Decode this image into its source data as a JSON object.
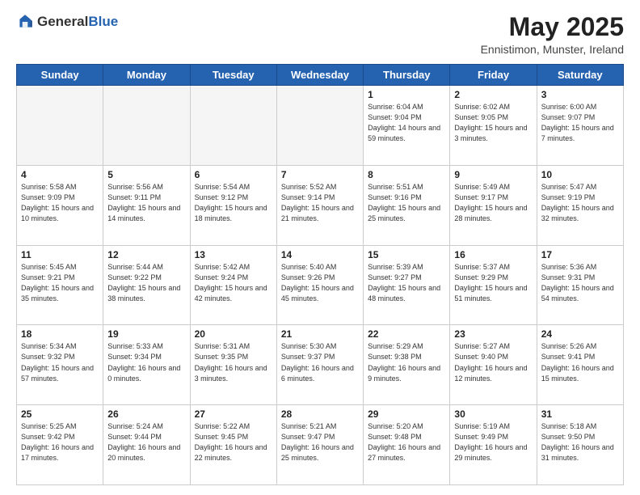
{
  "header": {
    "logo": {
      "general": "General",
      "blue": "Blue"
    },
    "title": "May 2025",
    "location": "Ennistimon, Munster, Ireland"
  },
  "weekdays": [
    "Sunday",
    "Monday",
    "Tuesday",
    "Wednesday",
    "Thursday",
    "Friday",
    "Saturday"
  ],
  "weeks": [
    [
      {
        "day": "",
        "sunrise": "",
        "sunset": "",
        "daylight": ""
      },
      {
        "day": "",
        "sunrise": "",
        "sunset": "",
        "daylight": ""
      },
      {
        "day": "",
        "sunrise": "",
        "sunset": "",
        "daylight": ""
      },
      {
        "day": "",
        "sunrise": "",
        "sunset": "",
        "daylight": ""
      },
      {
        "day": "1",
        "sunrise": "Sunrise: 6:04 AM",
        "sunset": "Sunset: 9:04 PM",
        "daylight": "Daylight: 14 hours and 59 minutes."
      },
      {
        "day": "2",
        "sunrise": "Sunrise: 6:02 AM",
        "sunset": "Sunset: 9:05 PM",
        "daylight": "Daylight: 15 hours and 3 minutes."
      },
      {
        "day": "3",
        "sunrise": "Sunrise: 6:00 AM",
        "sunset": "Sunset: 9:07 PM",
        "daylight": "Daylight: 15 hours and 7 minutes."
      }
    ],
    [
      {
        "day": "4",
        "sunrise": "Sunrise: 5:58 AM",
        "sunset": "Sunset: 9:09 PM",
        "daylight": "Daylight: 15 hours and 10 minutes."
      },
      {
        "day": "5",
        "sunrise": "Sunrise: 5:56 AM",
        "sunset": "Sunset: 9:11 PM",
        "daylight": "Daylight: 15 hours and 14 minutes."
      },
      {
        "day": "6",
        "sunrise": "Sunrise: 5:54 AM",
        "sunset": "Sunset: 9:12 PM",
        "daylight": "Daylight: 15 hours and 18 minutes."
      },
      {
        "day": "7",
        "sunrise": "Sunrise: 5:52 AM",
        "sunset": "Sunset: 9:14 PM",
        "daylight": "Daylight: 15 hours and 21 minutes."
      },
      {
        "day": "8",
        "sunrise": "Sunrise: 5:51 AM",
        "sunset": "Sunset: 9:16 PM",
        "daylight": "Daylight: 15 hours and 25 minutes."
      },
      {
        "day": "9",
        "sunrise": "Sunrise: 5:49 AM",
        "sunset": "Sunset: 9:17 PM",
        "daylight": "Daylight: 15 hours and 28 minutes."
      },
      {
        "day": "10",
        "sunrise": "Sunrise: 5:47 AM",
        "sunset": "Sunset: 9:19 PM",
        "daylight": "Daylight: 15 hours and 32 minutes."
      }
    ],
    [
      {
        "day": "11",
        "sunrise": "Sunrise: 5:45 AM",
        "sunset": "Sunset: 9:21 PM",
        "daylight": "Daylight: 15 hours and 35 minutes."
      },
      {
        "day": "12",
        "sunrise": "Sunrise: 5:44 AM",
        "sunset": "Sunset: 9:22 PM",
        "daylight": "Daylight: 15 hours and 38 minutes."
      },
      {
        "day": "13",
        "sunrise": "Sunrise: 5:42 AM",
        "sunset": "Sunset: 9:24 PM",
        "daylight": "Daylight: 15 hours and 42 minutes."
      },
      {
        "day": "14",
        "sunrise": "Sunrise: 5:40 AM",
        "sunset": "Sunset: 9:26 PM",
        "daylight": "Daylight: 15 hours and 45 minutes."
      },
      {
        "day": "15",
        "sunrise": "Sunrise: 5:39 AM",
        "sunset": "Sunset: 9:27 PM",
        "daylight": "Daylight: 15 hours and 48 minutes."
      },
      {
        "day": "16",
        "sunrise": "Sunrise: 5:37 AM",
        "sunset": "Sunset: 9:29 PM",
        "daylight": "Daylight: 15 hours and 51 minutes."
      },
      {
        "day": "17",
        "sunrise": "Sunrise: 5:36 AM",
        "sunset": "Sunset: 9:31 PM",
        "daylight": "Daylight: 15 hours and 54 minutes."
      }
    ],
    [
      {
        "day": "18",
        "sunrise": "Sunrise: 5:34 AM",
        "sunset": "Sunset: 9:32 PM",
        "daylight": "Daylight: 15 hours and 57 minutes."
      },
      {
        "day": "19",
        "sunrise": "Sunrise: 5:33 AM",
        "sunset": "Sunset: 9:34 PM",
        "daylight": "Daylight: 16 hours and 0 minutes."
      },
      {
        "day": "20",
        "sunrise": "Sunrise: 5:31 AM",
        "sunset": "Sunset: 9:35 PM",
        "daylight": "Daylight: 16 hours and 3 minutes."
      },
      {
        "day": "21",
        "sunrise": "Sunrise: 5:30 AM",
        "sunset": "Sunset: 9:37 PM",
        "daylight": "Daylight: 16 hours and 6 minutes."
      },
      {
        "day": "22",
        "sunrise": "Sunrise: 5:29 AM",
        "sunset": "Sunset: 9:38 PM",
        "daylight": "Daylight: 16 hours and 9 minutes."
      },
      {
        "day": "23",
        "sunrise": "Sunrise: 5:27 AM",
        "sunset": "Sunset: 9:40 PM",
        "daylight": "Daylight: 16 hours and 12 minutes."
      },
      {
        "day": "24",
        "sunrise": "Sunrise: 5:26 AM",
        "sunset": "Sunset: 9:41 PM",
        "daylight": "Daylight: 16 hours and 15 minutes."
      }
    ],
    [
      {
        "day": "25",
        "sunrise": "Sunrise: 5:25 AM",
        "sunset": "Sunset: 9:42 PM",
        "daylight": "Daylight: 16 hours and 17 minutes."
      },
      {
        "day": "26",
        "sunrise": "Sunrise: 5:24 AM",
        "sunset": "Sunset: 9:44 PM",
        "daylight": "Daylight: 16 hours and 20 minutes."
      },
      {
        "day": "27",
        "sunrise": "Sunrise: 5:22 AM",
        "sunset": "Sunset: 9:45 PM",
        "daylight": "Daylight: 16 hours and 22 minutes."
      },
      {
        "day": "28",
        "sunrise": "Sunrise: 5:21 AM",
        "sunset": "Sunset: 9:47 PM",
        "daylight": "Daylight: 16 hours and 25 minutes."
      },
      {
        "day": "29",
        "sunrise": "Sunrise: 5:20 AM",
        "sunset": "Sunset: 9:48 PM",
        "daylight": "Daylight: 16 hours and 27 minutes."
      },
      {
        "day": "30",
        "sunrise": "Sunrise: 5:19 AM",
        "sunset": "Sunset: 9:49 PM",
        "daylight": "Daylight: 16 hours and 29 minutes."
      },
      {
        "day": "31",
        "sunrise": "Sunrise: 5:18 AM",
        "sunset": "Sunset: 9:50 PM",
        "daylight": "Daylight: 16 hours and 31 minutes."
      }
    ]
  ]
}
